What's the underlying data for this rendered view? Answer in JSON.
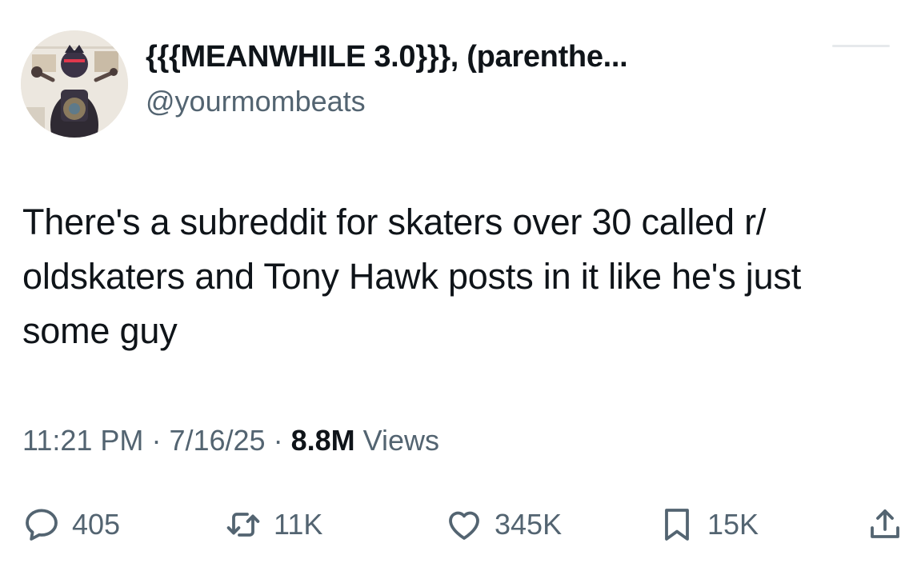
{
  "author": {
    "display_name": "{{{MEANWHILE 3.0}}}, (parenthe...",
    "handle": "@yourmombeats",
    "avatar_icon": "profile-photo-icon"
  },
  "tweet": {
    "text": "There's a subreddit for skaters over 30 called r/ oldskaters and Tony Hawk posts in it like he's just some guy"
  },
  "meta": {
    "time": "11:21 PM",
    "separator": "·",
    "date": "7/16/25",
    "views_count": "8.8M",
    "views_label": "Views"
  },
  "actions": {
    "reply": {
      "icon": "reply-icon",
      "count": "405"
    },
    "retweet": {
      "icon": "retweet-icon",
      "count": "11K"
    },
    "like": {
      "icon": "heart-icon",
      "count": "345K"
    },
    "bookmark": {
      "icon": "bookmark-icon",
      "count": "15K"
    },
    "share": {
      "icon": "share-icon"
    }
  },
  "colors": {
    "text_primary": "#0f1419",
    "text_secondary": "#536471",
    "background": "#ffffff"
  }
}
